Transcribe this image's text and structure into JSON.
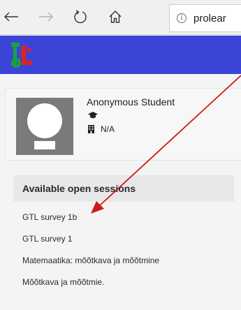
{
  "browser": {
    "url_text": "prolear",
    "info_glyph": "i",
    "icons": [
      "back-arrow-icon",
      "forward-arrow-icon",
      "refresh-icon",
      "home-icon",
      "info-icon"
    ]
  },
  "header": {
    "logo_icon": "app-logo-icon",
    "background_color": "#3b44d6"
  },
  "profile": {
    "name": "Anonymous Student",
    "role_icon": "graduation-cap-icon",
    "school_icon": "building-icon",
    "school": "N/A"
  },
  "sessions": {
    "title": "Available open sessions",
    "items": [
      "GTL survey 1b",
      "GTL survey 1",
      "Matemaatika: mõõtkava ja mõõtmine",
      "Mõõtkava ja mõõtmie."
    ]
  },
  "annotation": {
    "arrow_color": "#cc1a1a"
  }
}
